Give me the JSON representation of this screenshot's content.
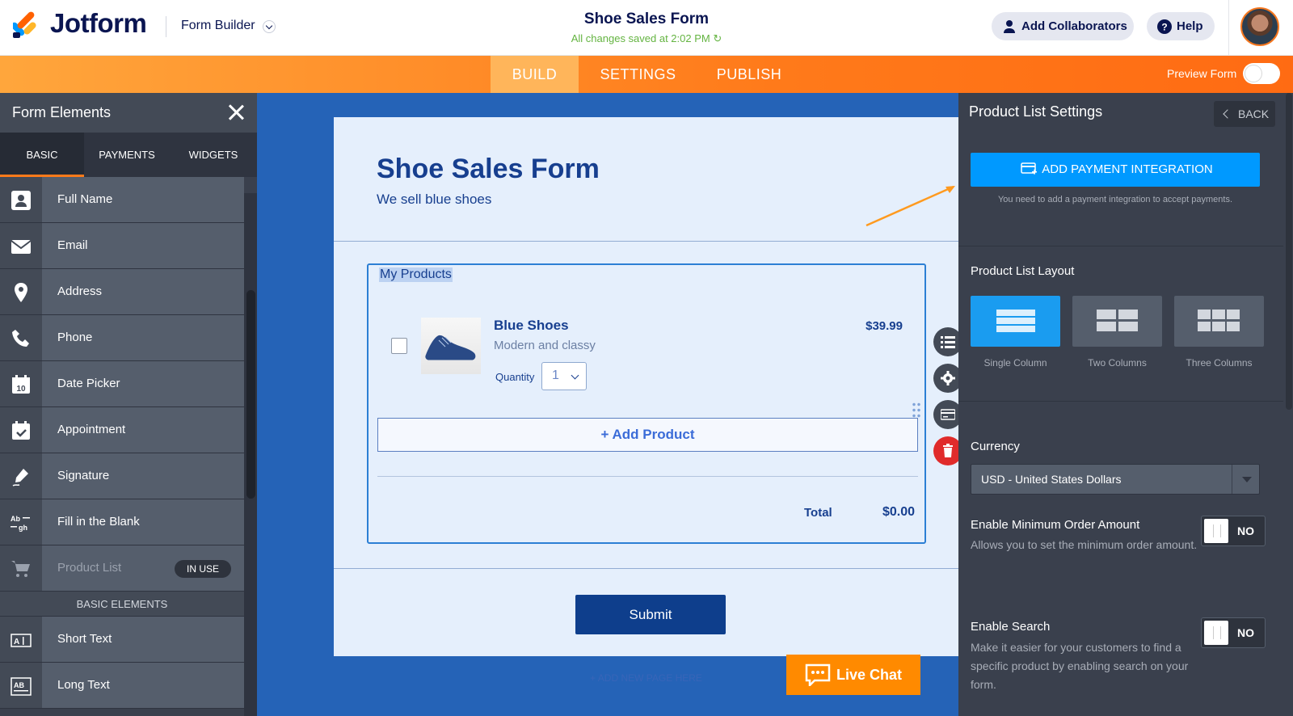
{
  "header": {
    "logo_text": "Jotform",
    "builder_label": "Form Builder",
    "form_title": "Shoe Sales Form",
    "saved_status": "All changes saved at 2:02 PM",
    "add_collaborators": "Add Collaborators",
    "help": "Help"
  },
  "nav": {
    "tabs": [
      "BUILD",
      "SETTINGS",
      "PUBLISH"
    ],
    "active_tab": "BUILD",
    "preview_label": "Preview Form",
    "preview_on": false
  },
  "left_panel": {
    "title": "Form Elements",
    "tabs": [
      "BASIC",
      "PAYMENTS",
      "WIDGETS"
    ],
    "active_tab": "BASIC",
    "items": [
      {
        "label": "Full Name",
        "icon": "person-card-icon"
      },
      {
        "label": "Email",
        "icon": "envelope-icon"
      },
      {
        "label": "Address",
        "icon": "map-pin-icon"
      },
      {
        "label": "Phone",
        "icon": "phone-icon"
      },
      {
        "label": "Date Picker",
        "icon": "calendar-10-icon"
      },
      {
        "label": "Appointment",
        "icon": "calendar-check-icon"
      },
      {
        "label": "Signature",
        "icon": "pen-icon"
      },
      {
        "label": "Fill in the Blank",
        "icon": "fill-blank-icon"
      },
      {
        "label": "Product List",
        "icon": "cart-icon",
        "badge": "IN USE"
      }
    ],
    "section_header": "BASIC ELEMENTS",
    "basic_items": [
      {
        "label": "Short Text",
        "icon": "short-text-icon"
      },
      {
        "label": "Long Text",
        "icon": "long-text-icon"
      }
    ]
  },
  "form": {
    "title": "Shoe Sales Form",
    "subtitle": "We sell blue shoes",
    "product_section_label": "My Products",
    "product": {
      "name": "Blue Shoes",
      "description": "Modern and classy",
      "price": "$39.99",
      "quantity_label": "Quantity",
      "quantity": "1"
    },
    "add_product": "+ Add Product",
    "total_label": "Total",
    "total_value": "$0.00",
    "submit": "Submit",
    "add_page": "+ ADD NEW PAGE HERE"
  },
  "live_chat": "Live Chat",
  "right_panel": {
    "title": "Product List Settings",
    "back": "BACK",
    "payment_button": "ADD PAYMENT INTEGRATION",
    "payment_note": "You need to add a payment integration to accept payments.",
    "layout_label": "Product List Layout",
    "layouts": [
      "Single Column",
      "Two Columns",
      "Three Columns"
    ],
    "selected_layout": "Single Column",
    "currency_label": "Currency",
    "currency_value": "USD - United States Dollars",
    "min_order_label": "Enable Minimum Order Amount",
    "min_order_desc": "Allows you to set the minimum order amount.",
    "min_order_toggle": "NO",
    "search_label": "Enable Search",
    "search_desc": "Make it easier for your customers to find a specific product by enabling search on your form.",
    "search_toggle": "NO"
  },
  "colors": {
    "brand_orange": "#ff7a1a",
    "canvas_blue": "#2563b7",
    "panel_dark": "#3a404d",
    "accent_blue": "#0099ff",
    "saved_green": "#64b441"
  }
}
